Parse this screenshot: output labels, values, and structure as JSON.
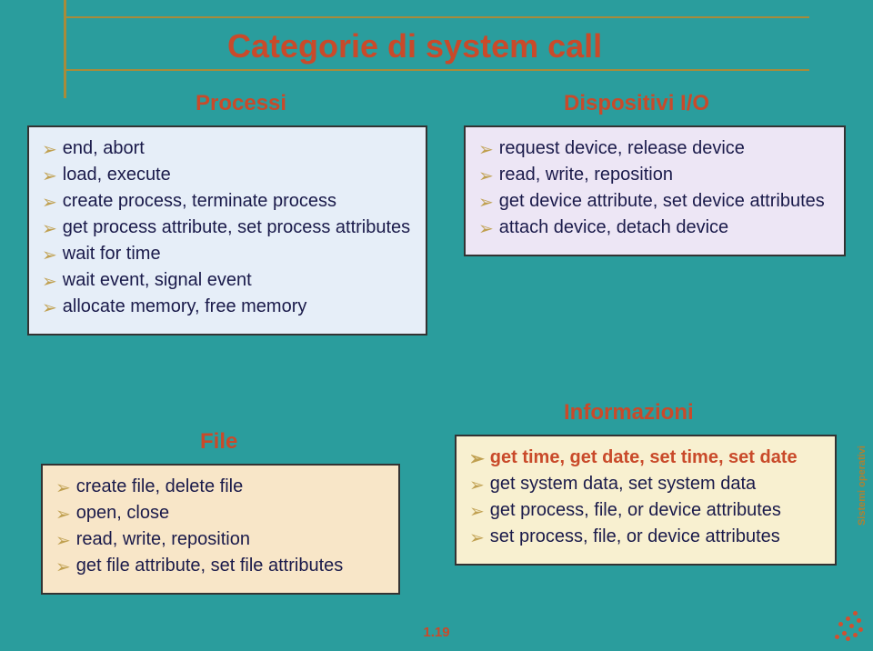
{
  "title": "Categorie di system call",
  "sections": {
    "processi": {
      "label": "Processi",
      "items": [
        "end, abort",
        "load, execute",
        "create process, terminate process",
        "get process attribute, set process attributes",
        "wait for time",
        "wait event, signal event",
        "allocate memory, free memory"
      ]
    },
    "dispositivi": {
      "label": "Dispositivi I/O",
      "items": [
        "request device, release device",
        "read, write, reposition",
        "get device attribute, set device attributes",
        "attach device, detach device"
      ]
    },
    "file": {
      "label": "File",
      "items": [
        "create file, delete file",
        "open, close",
        "read, write, reposition",
        "get file attribute, set file attributes"
      ]
    },
    "info": {
      "label": "Informazioni",
      "items": [
        "get time, get date, set time, set date",
        "get system data, set system data",
        "get process, file, or device attributes",
        "set process, file, or device attributes"
      ]
    }
  },
  "slide_number": "1.19",
  "side_text": "Sistemi operativi"
}
